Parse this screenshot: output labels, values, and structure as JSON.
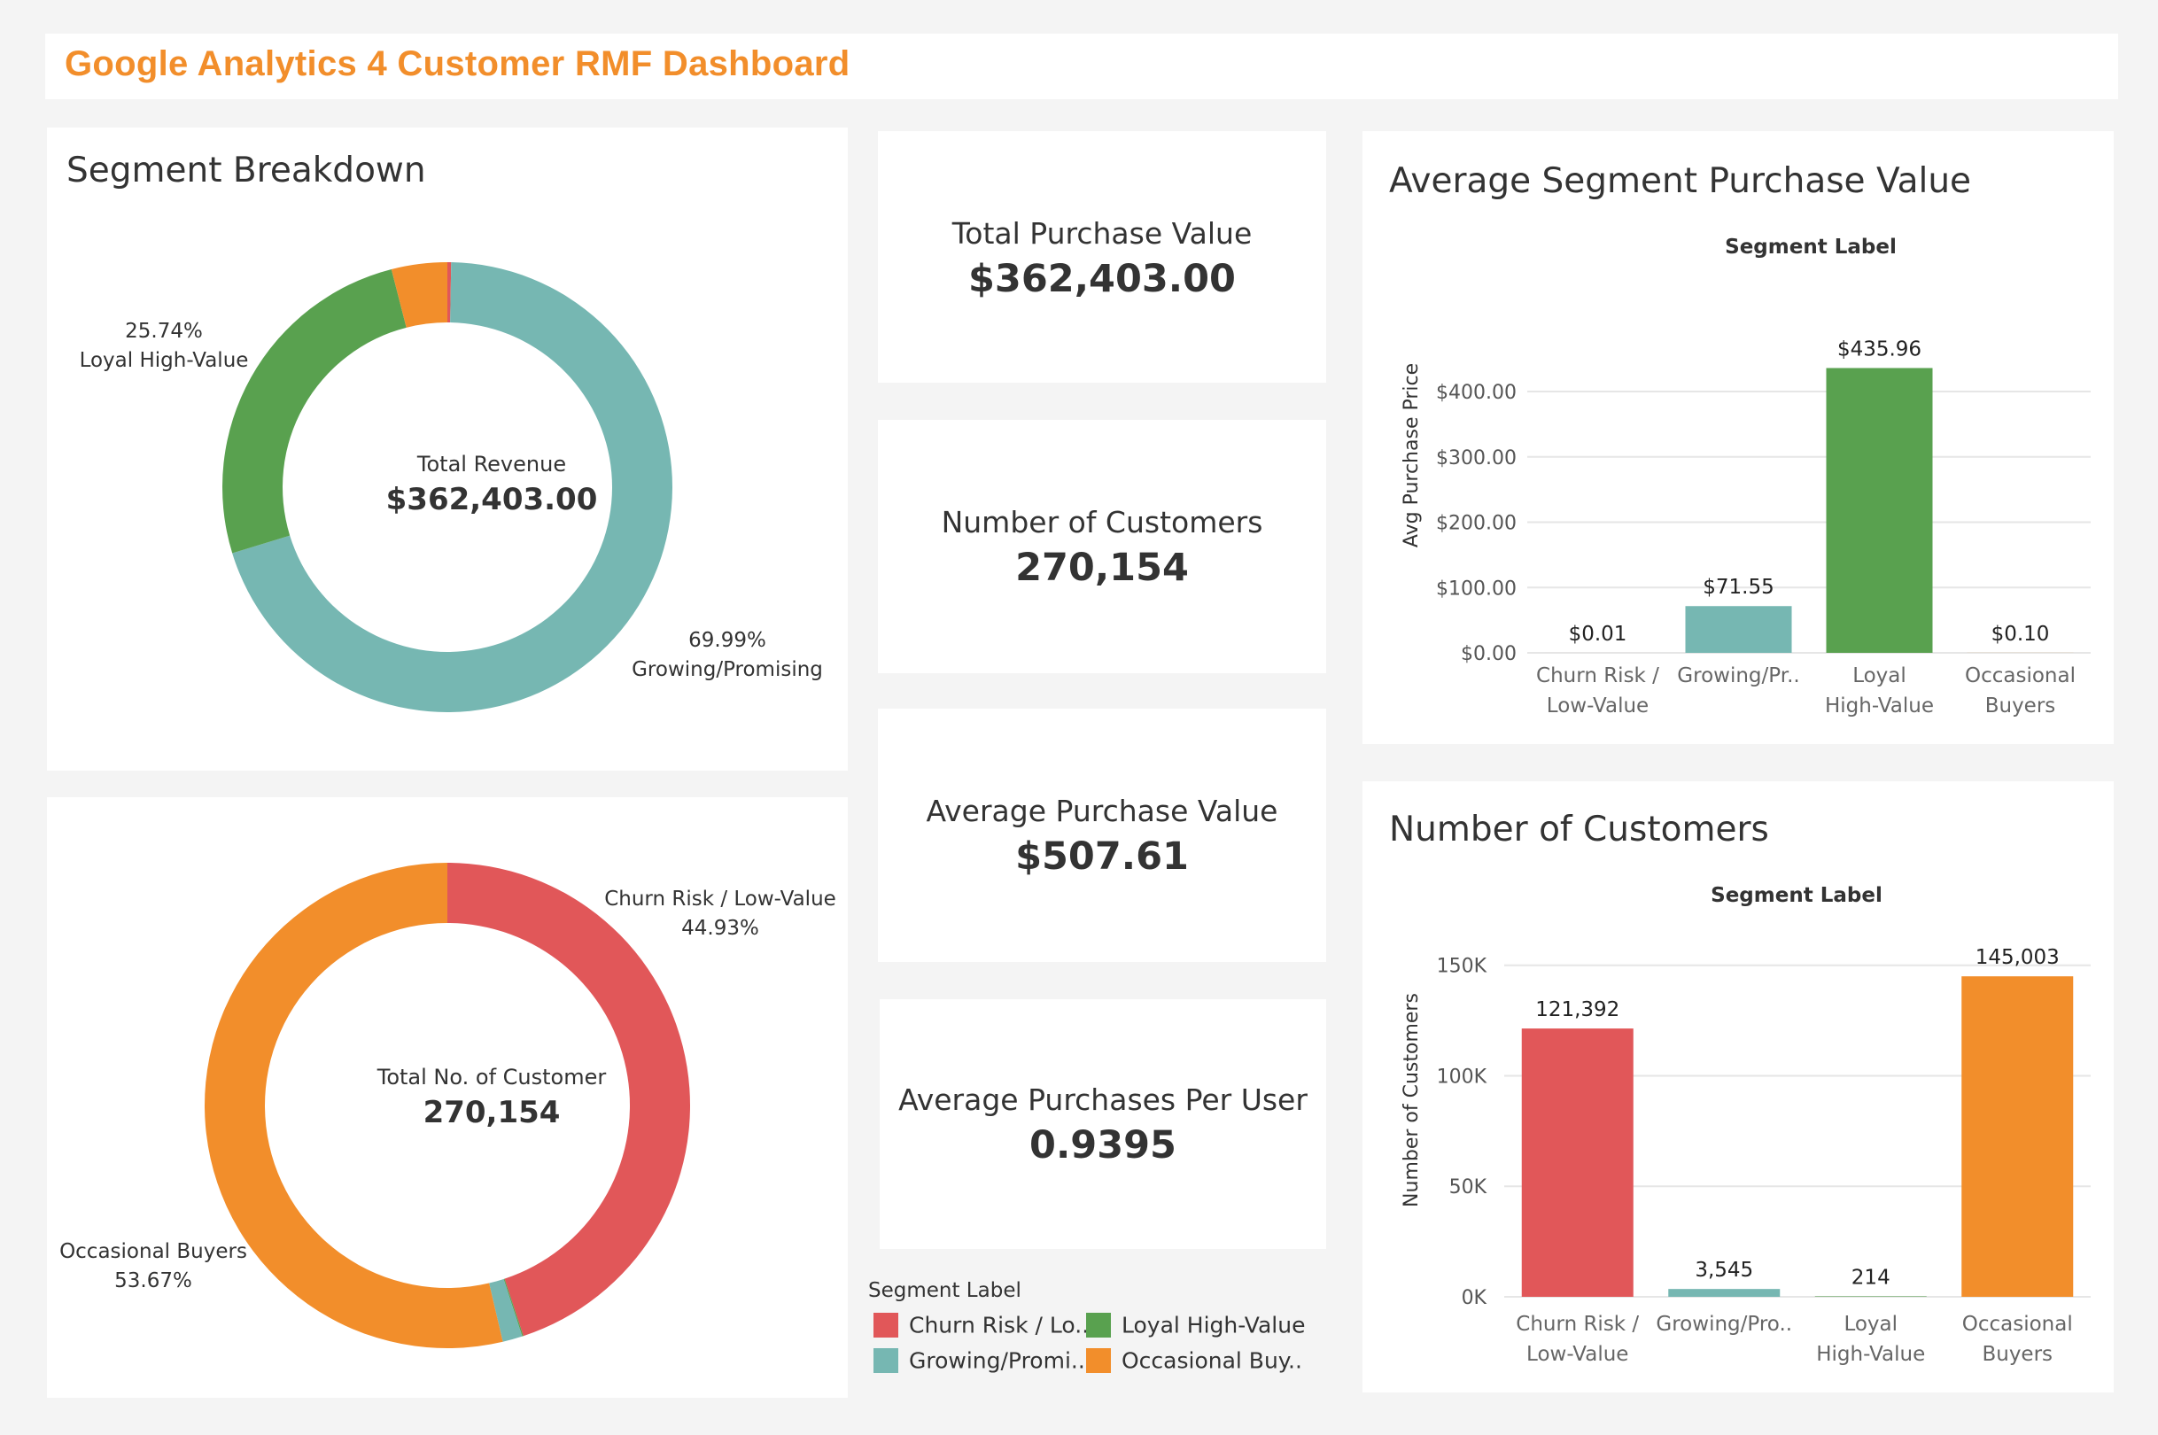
{
  "dashboard_title": "Google Analytics 4 Customer RMF Dashboard",
  "colors": {
    "churn": "#e15759",
    "growing": "#76b7b2",
    "loyal": "#59a14f",
    "occasional": "#f28e2b",
    "title": "#f28e2b"
  },
  "segment_breakdown": {
    "title": "Segment Breakdown",
    "revenue_center_label": "Total Revenue",
    "revenue_center_value": "$362,403.00",
    "customers_center_label": "Total No. of Customer",
    "customers_center_value": "270,154"
  },
  "kpis": [
    {
      "label": "Total Purchase Value",
      "value": "$362,403.00"
    },
    {
      "label": "Number of Customers",
      "value": "270,154"
    },
    {
      "label": "Average Purchase Value",
      "value": "$507.61"
    },
    {
      "label": "Average Purchases Per User",
      "value": "0.9395"
    }
  ],
  "legend": {
    "title": "Segment Label",
    "items": [
      {
        "label": "Churn Risk / Lo..",
        "color": "#e15759"
      },
      {
        "label": "Loyal High-Value",
        "color": "#59a14f"
      },
      {
        "label": "Growing/Promi..",
        "color": "#76b7b2"
      },
      {
        "label": "Occasional Buy..",
        "color": "#f28e2b"
      }
    ]
  },
  "avg_panel": {
    "title": "Average Segment Purchase Value",
    "header": "Segment Label",
    "ylabel": "Avg Purchase Price",
    "tick_labels": [
      "$0.00",
      "$100.00",
      "$200.00",
      "$300.00",
      "$400.00"
    ],
    "category_lines": [
      [
        "Churn Risk /",
        "Low-Value"
      ],
      [
        "Growing/Pr..",
        ""
      ],
      [
        "Loyal",
        "High-Value"
      ],
      [
        "Occasional",
        "Buyers"
      ]
    ],
    "data_labels": [
      "$0.01",
      "$71.55",
      "$435.96",
      "$0.10"
    ]
  },
  "count_panel": {
    "title": "Number of Customers",
    "header": "Segment Label",
    "ylabel": "Number of Customers",
    "tick_labels": [
      "0K",
      "50K",
      "100K",
      "150K"
    ],
    "category_lines": [
      [
        "Churn Risk /",
        "Low-Value"
      ],
      [
        "Growing/Pro..",
        ""
      ],
      [
        "Loyal",
        "High-Value"
      ],
      [
        "Occasional",
        "Buyers"
      ]
    ],
    "data_labels": [
      "121,392",
      "3,545",
      "214",
      "145,003"
    ]
  },
  "chart_data": [
    {
      "type": "pie",
      "title": "Segment Breakdown",
      "center_label": "Total Revenue",
      "center_value": "$362,403.00",
      "slices": [
        {
          "name": "Growing/Promising",
          "value": 69.99,
          "color": "#76b7b2",
          "label_lines": [
            "69.99%",
            "Growing/Promising"
          ]
        },
        {
          "name": "Loyal High-Value",
          "value": 25.74,
          "color": "#59a14f",
          "label_lines": [
            "25.74%",
            "Loyal High-Value"
          ]
        },
        {
          "name": "Occasional Buyers",
          "value": 4.0,
          "color": "#f28e2b",
          "label_lines": []
        },
        {
          "name": "Churn Risk / Low-Value",
          "value": 0.27,
          "color": "#e15759",
          "label_lines": []
        }
      ]
    },
    {
      "type": "pie",
      "center_label": "Total No. of Customer",
      "center_value": "270,154",
      "slices": [
        {
          "name": "Churn Risk / Low-Value",
          "value": 44.93,
          "color": "#e15759",
          "label_lines": [
            "Churn Risk / Low-Value",
            "44.93%"
          ]
        },
        {
          "name": "Loyal High-Value",
          "value": 0.08,
          "color": "#59a14f",
          "label_lines": []
        },
        {
          "name": "Growing/Promising",
          "value": 1.32,
          "color": "#76b7b2",
          "label_lines": []
        },
        {
          "name": "Occasional Buyers",
          "value": 53.67,
          "color": "#f28e2b",
          "label_lines": [
            "Occasional Buyers",
            "53.67%"
          ]
        }
      ]
    },
    {
      "type": "bar",
      "title": "Average Segment Purchase Value",
      "ylabel": "Avg Purchase Price",
      "categories": [
        "Churn Risk / Low-Value",
        "Growing/Promising",
        "Loyal High-Value",
        "Occasional Buyers"
      ],
      "values": [
        0.01,
        71.55,
        435.96,
        0.1
      ],
      "colors": [
        "#e15759",
        "#76b7b2",
        "#59a14f",
        "#f28e2b"
      ],
      "ylim": [
        0,
        480
      ],
      "yticks": [
        0,
        100,
        200,
        300,
        400
      ],
      "grid": true
    },
    {
      "type": "bar",
      "title": "Number of Customers",
      "ylabel": "Number of Customers",
      "categories": [
        "Churn Risk / Low-Value",
        "Growing/Promising",
        "Loyal High-Value",
        "Occasional Buyers"
      ],
      "values": [
        121392,
        3545,
        214,
        145003
      ],
      "colors": [
        "#e15759",
        "#76b7b2",
        "#59a14f",
        "#f28e2b"
      ],
      "ylim": [
        0,
        157500
      ],
      "yticks": [
        0,
        50000,
        100000,
        150000
      ],
      "grid": true
    }
  ]
}
